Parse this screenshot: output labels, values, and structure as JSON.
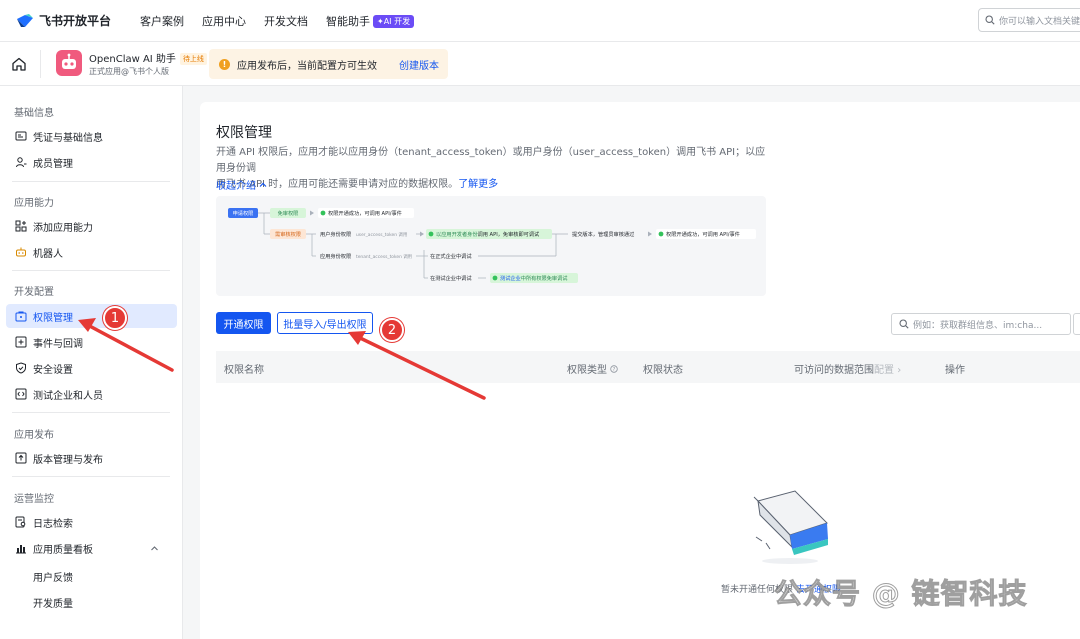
{
  "topnav": {
    "logo": "飞书开放平台",
    "items": [
      "客户案例",
      "应用中心",
      "开发文档",
      "智能助手"
    ],
    "ai_badge": "✦AI 开发",
    "search_placeholder": "你可以输入文档关键"
  },
  "app": {
    "name": "OpenClaw AI 助手",
    "tag": "待上线",
    "subtitle": "正式应用@飞书个人版"
  },
  "notice": {
    "text": "应用发布后，当前配置方可生效",
    "link": "创建版本"
  },
  "sidebar": {
    "sections": [
      {
        "title": "基础信息",
        "items": [
          "凭证与基础信息",
          "成员管理"
        ]
      },
      {
        "title": "应用能力",
        "items": [
          "添加应用能力",
          "机器人"
        ]
      },
      {
        "title": "开发配置",
        "items": [
          "权限管理",
          "事件与回调",
          "安全设置",
          "测试企业和人员"
        ]
      },
      {
        "title": "应用发布",
        "items": [
          "版本管理与发布"
        ]
      },
      {
        "title": "运营监控",
        "items": [
          "日志检索",
          "应用质量看板"
        ]
      }
    ],
    "sub_items": [
      "用户反馈",
      "开发质量"
    ],
    "active": "权限管理"
  },
  "main": {
    "title": "权限管理",
    "desc_line1": "开通 API 权限后，应用才能以应用身份（tenant_access_token）或用户身份（user_access_token）调用飞书 API；以应用身份调",
    "desc_line2": "用飞书 API 时，应用可能还需要申请对应的数据权限。",
    "learn_more": "了解更多",
    "collapse": "收起介绍",
    "flow": {
      "apply": "申请权限",
      "free_review": "免审权限",
      "free_result": "权限开通成功，可调用 API/事件",
      "need_review": "需审核权限",
      "user_perm": "用户身份权限",
      "user_token": "user_access_token 调用",
      "user_result_a": "以应用开发者身份",
      "user_result_b": "调用 API，免审核即可调试",
      "app_perm": "应用身份权限",
      "app_token": "tenant_access_token 调用",
      "submit": "提交版本，管理员审核通过",
      "final_result": "权限开通成功，可调用 API/事件",
      "formal_test": "在正式企业中调试",
      "test_env": "在测试企业中调试",
      "test_result_a": "测试企业",
      "test_result_b": "中所有权限免审调试"
    },
    "btn_open": "开通权限",
    "btn_batch": "批量导入/导出权限",
    "search_placeholder": "例如：获取群组信息、im:cha...",
    "columns": {
      "name": "权限名称",
      "type": "权限类型",
      "status": "权限状态",
      "scope": "可访问的数据范围",
      "scope_config": "配置",
      "action": "操作"
    },
    "empty_prefix": "暂未开通任何权限",
    "empty_link": "去开通权限"
  },
  "annotations": {
    "badge1": "1",
    "badge2": "2"
  },
  "watermark": "公众号 @ 链智科技",
  "colors": {
    "primary": "#1456f0",
    "arrow": "#e53935",
    "active_bg": "#e1eaff"
  }
}
